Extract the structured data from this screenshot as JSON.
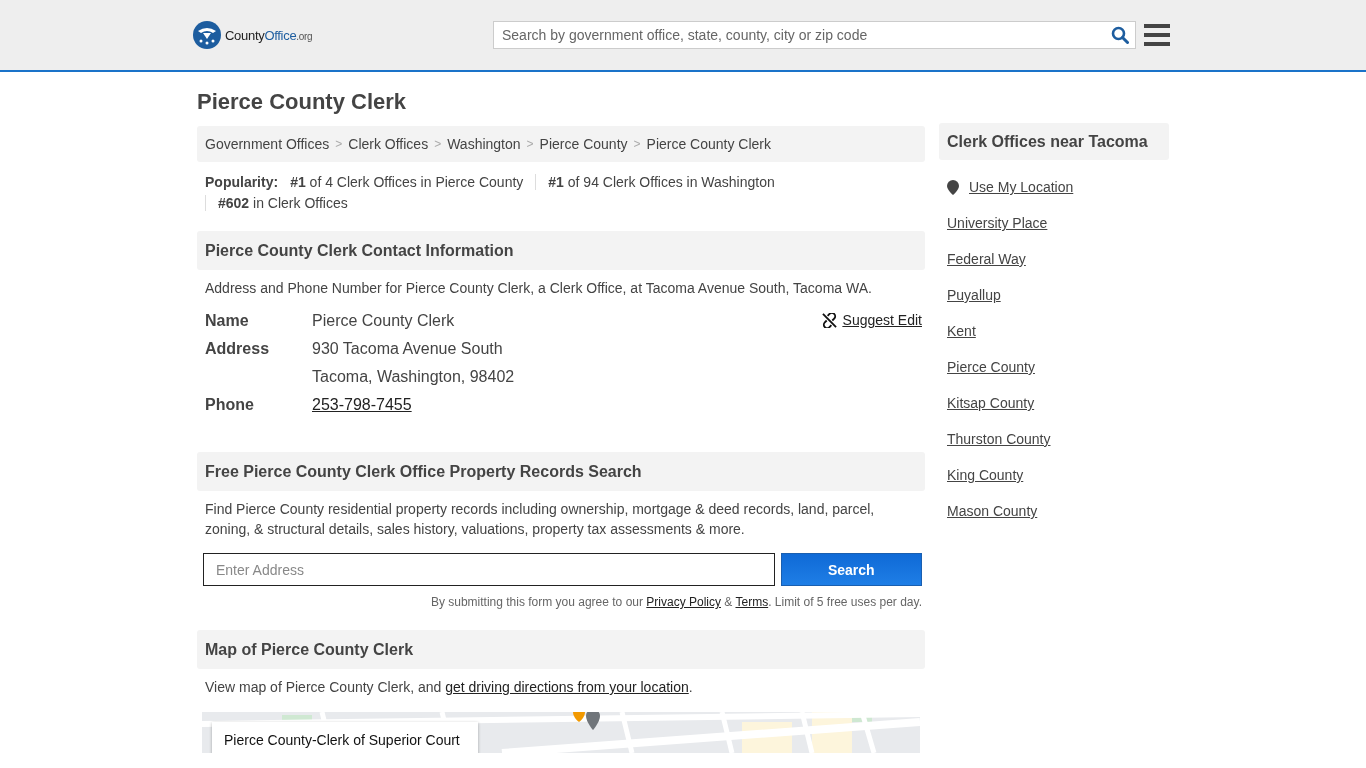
{
  "header": {
    "logo": {
      "name": "County",
      "name_bold": "Office",
      "suffix": ".org"
    },
    "search": {
      "placeholder": "Search by government office, state, county, city or zip code"
    }
  },
  "page_title": "Pierce County Clerk",
  "breadcrumbs": [
    {
      "label": "Government Offices",
      "separator_after": ">"
    },
    {
      "label": "Clerk Offices",
      "separator_after": ">"
    },
    {
      "label": "Washington",
      "separator_after": ">"
    },
    {
      "label": "Pierce County",
      "separator_after": ">"
    },
    {
      "label": "Pierce County Clerk"
    }
  ],
  "popularity": {
    "label": "Popularity:",
    "items": [
      {
        "rank": "#1",
        "text": "of 4 Clerk Offices in Pierce County"
      },
      {
        "rank": "#1",
        "text": "of 94 Clerk Offices in Washington"
      },
      {
        "rank": "#602",
        "text": "in Clerk Offices"
      }
    ]
  },
  "contact": {
    "heading": "Pierce County Clerk Contact Information",
    "description": "Address and Phone Number for Pierce County Clerk, a Clerk Office, at Tacoma Avenue South, Tacoma WA.",
    "suggest_edit": "Suggest Edit",
    "fields": [
      {
        "label": "Name",
        "kind": "text",
        "lines": [
          "Pierce County Clerk"
        ]
      },
      {
        "label": "Address",
        "kind": "text",
        "lines": [
          "930 Tacoma Avenue South",
          "Tacoma, Washington, 98402"
        ]
      },
      {
        "label": "Phone",
        "kind": "link",
        "lines": [
          "253-798-7455"
        ]
      }
    ]
  },
  "property": {
    "heading": "Free Pierce County Clerk Office Property Records Search",
    "description": "Find Pierce County residential property records including ownership, mortgage & deed records, land, parcel, zoning, & structural details, sales history, valuations, property tax assessments & more.",
    "placeholder": "Enter Address",
    "button": "Search",
    "note_before": "By submitting this form you agree to our",
    "privacy": "Privacy Policy",
    "amp": "&",
    "terms": "Terms",
    "note_after": ". Limit of 5 free uses per day."
  },
  "map": {
    "heading": "Map of Pierce County Clerk",
    "text": "View map of Pierce County Clerk, and",
    "link": "get driving directions from your location",
    "end": ".",
    "card_title": "Pierce County-Clerk of Superior Court"
  },
  "sidebar": {
    "heading": "Clerk Offices near Tacoma",
    "location": "Use My Location",
    "links": [
      "University Place",
      "Federal Way",
      "Puyallup",
      "Kent",
      "Pierce County",
      "Kitsap County",
      "Thurston County",
      "King County",
      "Mason County"
    ]
  }
}
